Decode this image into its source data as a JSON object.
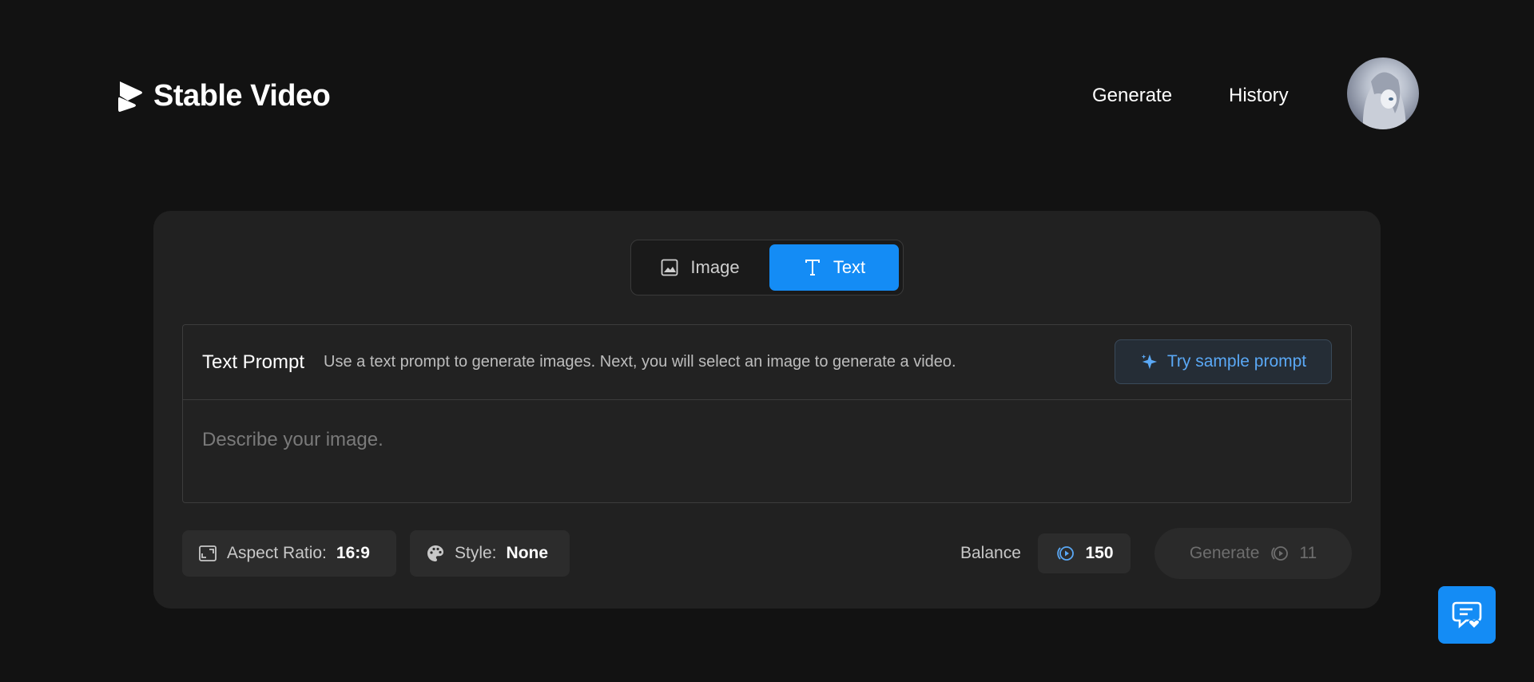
{
  "app": {
    "brand_name": "Stable Video",
    "accent_color": "#148cf5"
  },
  "nav": {
    "generate_label": "Generate",
    "history_label": "History"
  },
  "mode_toggle": {
    "options": [
      {
        "label": "Image",
        "icon": "image-icon",
        "active": false
      },
      {
        "label": "Text",
        "icon": "text-icon",
        "active": true
      }
    ]
  },
  "prompt": {
    "title": "Text Prompt",
    "help": "Use a text prompt to generate images. Next, you will select an image to generate a video.",
    "sample_label": "Try sample prompt",
    "placeholder": "Describe your image.",
    "value": ""
  },
  "controls": {
    "aspect_ratio_label": "Aspect Ratio:",
    "aspect_ratio_value": "16:9",
    "style_label": "Style:",
    "style_value": "None",
    "balance_label": "Balance",
    "balance_value": "150",
    "generate_label": "Generate",
    "generate_cost": "11"
  }
}
